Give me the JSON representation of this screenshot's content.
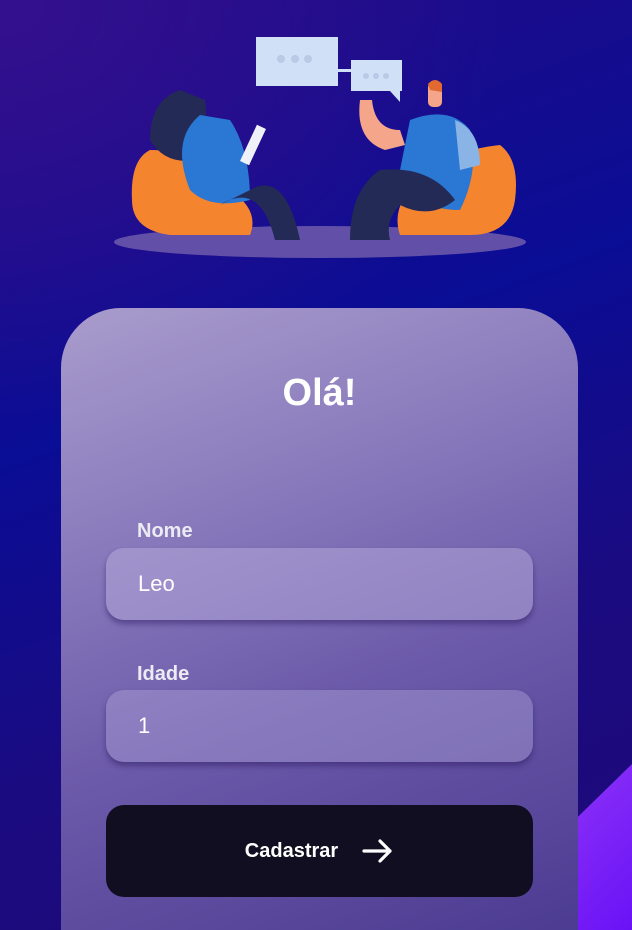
{
  "card": {
    "title": "Olá!"
  },
  "form": {
    "name_label": "Nome",
    "name_value": "Leo",
    "age_label": "Idade",
    "age_value": "1",
    "submit_label": "Cadastrar"
  },
  "colors": {
    "button": "#100e20",
    "accent": "#8a2be2"
  }
}
